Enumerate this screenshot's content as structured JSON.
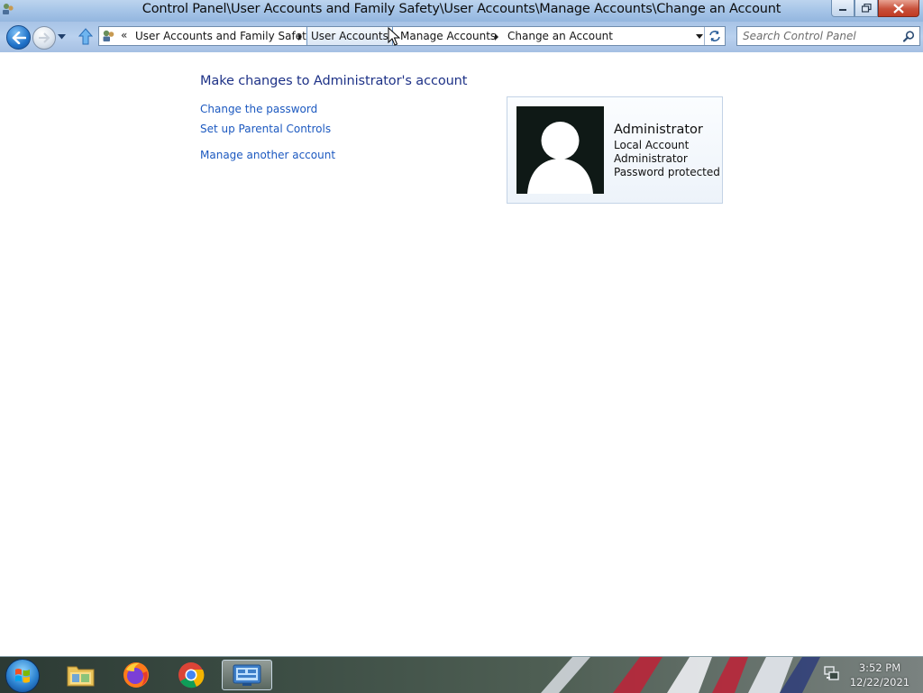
{
  "window": {
    "title": "Control Panel\\User Accounts and Family Safety\\User Accounts\\Manage Accounts\\Change an Account"
  },
  "addressbar": {
    "overflow": "«",
    "crumbs": [
      "User Accounts and Family Safety",
      "User Accounts",
      "Manage Accounts",
      "Change an Account"
    ]
  },
  "search": {
    "placeholder": "Search Control Panel"
  },
  "main": {
    "heading": "Make changes to Administrator's account",
    "tasks": [
      "Change the password",
      "Set up Parental Controls",
      "Manage another account"
    ]
  },
  "account": {
    "name": "Administrator",
    "lines": [
      "Local Account",
      "Administrator",
      "Password protected"
    ]
  },
  "taskbar": {
    "apps": [
      "folder-icon",
      "firefox-icon",
      "chrome-icon",
      "control-panel-icon"
    ],
    "clock_time": "3:52 PM",
    "clock_date": "12/22/2021"
  },
  "colors": {
    "heading": "#1e3287",
    "link": "#1c59c0",
    "title_bar": "#a8c6e8",
    "close_button": "#c8503a"
  }
}
